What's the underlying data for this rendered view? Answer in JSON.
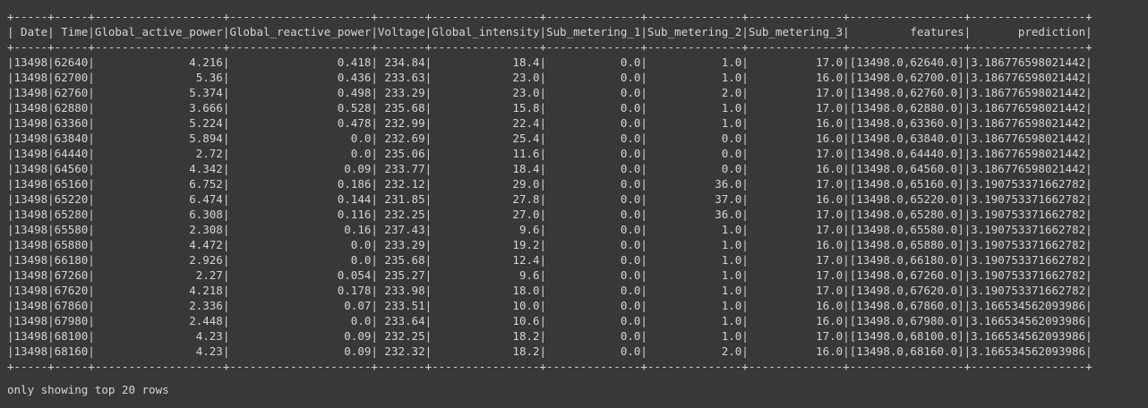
{
  "table": {
    "border_line": "+-----+-----+-------------------+---------------------+-------+----------------+--------------+--------------+--------------+-----------------+-----------------+",
    "header_line": "| Date| Time|Global_active_power|Global_reactive_power|Voltage|Global_intensity|Sub_metering_1|Sub_metering_2|Sub_metering_3|         features|       prediction|",
    "rows": [
      "|13498|62640|              4.216|                0.418| 234.84|            18.4|           0.0|           1.0|          17.0|[13498.0,62640.0]|3.186776598021442|",
      "|13498|62700|               5.36|                0.436| 233.63|            23.0|           0.0|           1.0|          16.0|[13498.0,62700.0]|3.186776598021442|",
      "|13498|62760|              5.374|                0.498| 233.29|            23.0|           0.0|           2.0|          17.0|[13498.0,62760.0]|3.186776598021442|",
      "|13498|62880|              3.666|                0.528| 235.68|            15.8|           0.0|           1.0|          17.0|[13498.0,62880.0]|3.186776598021442|",
      "|13498|63360|              5.224|                0.478| 232.99|            22.4|           0.0|           1.0|          16.0|[13498.0,63360.0]|3.186776598021442|",
      "|13498|63840|              5.894|                  0.0| 232.69|            25.4|           0.0|           0.0|          16.0|[13498.0,63840.0]|3.186776598021442|",
      "|13498|64440|               2.72|                  0.0| 235.06|            11.6|           0.0|           0.0|          17.0|[13498.0,64440.0]|3.186776598021442|",
      "|13498|64560|              4.342|                 0.09| 233.77|            18.4|           0.0|           0.0|          16.0|[13498.0,64560.0]|3.186776598021442|",
      "|13498|65160|              6.752|                0.186| 232.12|            29.0|           0.0|          36.0|          17.0|[13498.0,65160.0]|3.190753371662782|",
      "|13498|65220|              6.474|                0.144| 231.85|            27.8|           0.0|          37.0|          16.0|[13498.0,65220.0]|3.190753371662782|",
      "|13498|65280|              6.308|                0.116| 232.25|            27.0|           0.0|          36.0|          17.0|[13498.0,65280.0]|3.190753371662782|",
      "|13498|65580|              2.308|                 0.16| 237.43|             9.6|           0.0|           1.0|          17.0|[13498.0,65580.0]|3.190753371662782|",
      "|13498|65880|              4.472|                  0.0| 233.29|            19.2|           0.0|           1.0|          16.0|[13498.0,65880.0]|3.190753371662782|",
      "|13498|66180|              2.926|                  0.0| 235.68|            12.4|           0.0|           1.0|          17.0|[13498.0,66180.0]|3.190753371662782|",
      "|13498|67260|               2.27|                0.054| 235.27|             9.6|           0.0|           1.0|          17.0|[13498.0,67260.0]|3.190753371662782|",
      "|13498|67620|              4.218|                0.178| 233.98|            18.0|           0.0|           1.0|          17.0|[13498.0,67620.0]|3.190753371662782|",
      "|13498|67860|              2.336|                 0.07| 233.51|            10.0|           0.0|           1.0|          16.0|[13498.0,67860.0]|3.166534562093986|",
      "|13498|67980|              2.448|                  0.0| 233.64|            10.6|           0.0|           1.0|          16.0|[13498.0,67980.0]|3.166534562093986|",
      "|13498|68100|               4.23|                 0.09| 232.25|            18.2|           0.0|           1.0|          17.0|[13498.0,68100.0]|3.166534562093986|",
      "|13498|68160|               4.23|                 0.09| 232.32|            18.2|           0.0|           2.0|          16.0|[13498.0,68160.0]|3.166534562093986|"
    ]
  },
  "footer": "only showing top 20 rows",
  "colors": {
    "background": "#383838",
    "text": "#d5d5d5"
  }
}
